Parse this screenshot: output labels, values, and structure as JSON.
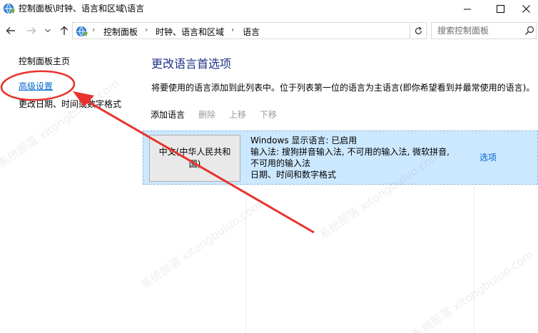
{
  "window": {
    "title": "控制面板\\时钟、语言和区域\\语言"
  },
  "address_bar": {
    "breadcrumbs": [
      "控制面板",
      "时钟、语言和区域",
      "语言"
    ],
    "separator": "›"
  },
  "search": {
    "placeholder": "搜索控制面板"
  },
  "left_pane": {
    "home_link": "控制面板主页",
    "advanced_link": "高级设置",
    "date_link": "更改日期、时间或数字格式"
  },
  "main": {
    "heading": "更改语言首选项",
    "description": "将要使用的语言添加到此列表中。位于列表第一位的语言为主语言(即你希望看到并最常使用的语言)。",
    "toolbar": {
      "add": "添加语言",
      "remove": "删除",
      "move_up": "上移",
      "move_down": "下移"
    },
    "languages": [
      {
        "name": "中文(中华人民共和国)",
        "info_lines": [
          "Windows 显示语言: 已启用",
          "输入法: 搜狗拼音输入法, 不可用的输入法, 微软拼音,",
          "不可用的输入法",
          "日期、时间和数字格式"
        ],
        "options_label": "选项"
      }
    ]
  },
  "icons": {
    "minimize": "minimize-icon",
    "maximize": "maximize-icon",
    "close": "close-icon",
    "back": "back-arrow-icon",
    "forward": "forward-arrow-icon",
    "up": "up-arrow-icon",
    "refresh": "refresh-icon",
    "search": "search-icon"
  },
  "colors": {
    "link": "#0066cc",
    "heading": "#1e3287",
    "selection": "#cce8ff",
    "annotation": "#e8322d"
  },
  "watermark_text": "系统部落 xitongbuluo.com"
}
